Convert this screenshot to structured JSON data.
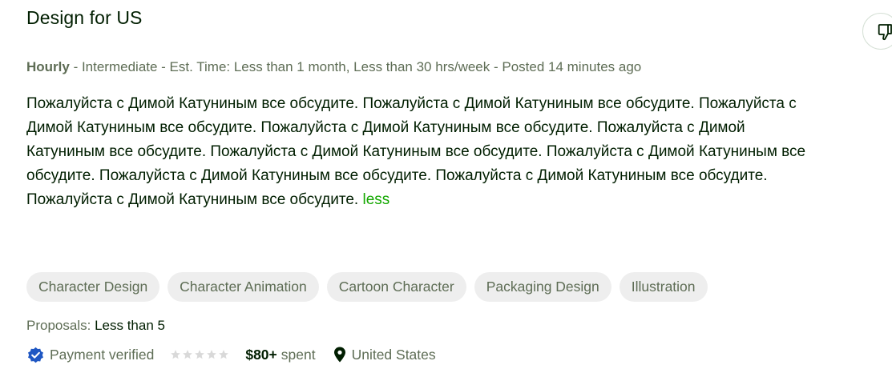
{
  "job": {
    "title": "Design for US",
    "meta": {
      "type": "Hourly",
      "details": " - Intermediate - Est. Time: Less than 1 month, Less than 30 hrs/week - Posted 14 minutes ago"
    },
    "description": "Пожалуйста с Димой Катуниным все обсудите. Пожалуйста с Димой Катуниным все обсудите. Пожалуйста с Димой Катуниным все обсудите. Пожалуйста с Димой Катуниным все обсудите. Пожалуйста с Димой Катуниным все обсудите. Пожалуйста с Димой Катуниным все обсудите. Пожалуйста с Димой Катуниным все обсудите. Пожалуйста с Димой Катуниным все обсудите. Пожалуйста с Димой Катуниным все обсудите. Пожалуйста с Димой Катуниным все обсудите.",
    "less_link": "less",
    "tags": [
      "Character Design",
      "Character Animation",
      "Cartoon Character",
      "Packaging Design",
      "Illustration"
    ],
    "proposals_label": "Proposals:",
    "proposals_value": "Less than 5",
    "payment_status": "Payment verified",
    "rating_stars": 0,
    "spent_amount": "$80+",
    "spent_label": "spent",
    "location": "United States"
  },
  "icons": {
    "dislike": "thumbs-down-icon",
    "verified": "verified-badge-icon",
    "location": "location-pin-icon",
    "star": "star-icon"
  },
  "colors": {
    "accent_green": "#14a800",
    "verified_blue": "#1f57c3",
    "tag_bg": "#eeeeee",
    "muted_text": "#5e6d55",
    "star_empty": "#d9d9d9"
  }
}
